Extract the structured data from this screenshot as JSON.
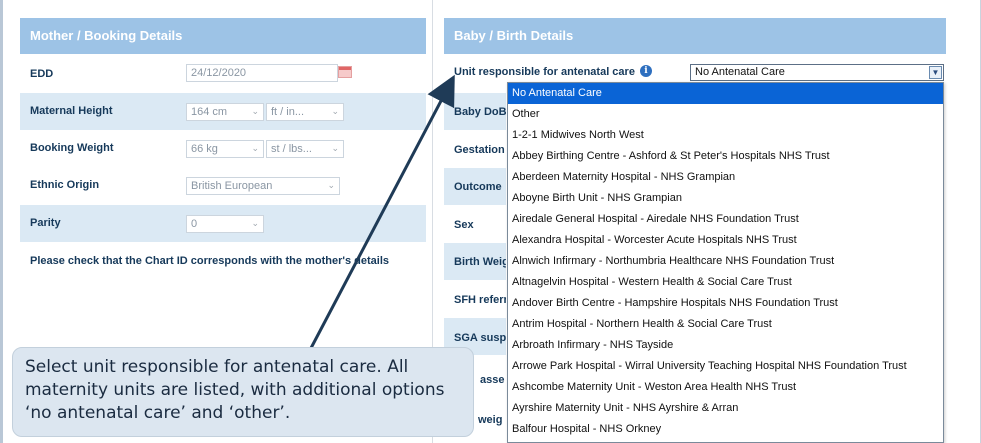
{
  "mother_panel": {
    "title": "Mother / Booking Details",
    "edd": {
      "label": "EDD",
      "value": "24/12/2020"
    },
    "maternal_height": {
      "label": "Maternal Height",
      "value": "164 cm",
      "unit": "ft / in..."
    },
    "booking_weight": {
      "label": "Booking Weight",
      "value": "66 kg",
      "unit": "st / lbs..."
    },
    "ethnic_origin": {
      "label": "Ethnic Origin",
      "value": "British European"
    },
    "parity": {
      "label": "Parity",
      "value": "0"
    },
    "note": "Please check that the Chart ID corresponds with the mother's details"
  },
  "baby_panel": {
    "title": "Baby / Birth Details",
    "unit_label": "Unit responsible for antenatal care",
    "unit_value": "No Antenatal Care",
    "partial_labels": [
      "Baby DoB",
      "Gestation",
      "Outcome",
      "Sex",
      "Birth Weig",
      "SFH referr",
      "SGA susp",
      "asse",
      "weig"
    ]
  },
  "dropdown": {
    "options": [
      "No Antenatal Care",
      "Other",
      "1-2-1 Midwives North West",
      "Abbey Birthing Centre - Ashford & St Peter's Hospitals NHS Trust",
      "Aberdeen Maternity Hospital - NHS Grampian",
      "Aboyne Birth Unit - NHS Grampian",
      "Airedale General Hospital - Airedale NHS Foundation Trust",
      "Alexandra Hospital - Worcester Acute Hospitals NHS Trust",
      "Alnwich Infirmary - Northumbria Healthcare NHS Foundation Trust",
      "Altnagelvin Hospital - Western Health & Social Care Trust",
      "Andover Birth Centre - Hampshire Hospitals NHS Foundation Trust",
      "Antrim Hospital - Northern Health & Social Care Trust",
      "Arbroath Infirmary - NHS Tayside",
      "Arrowe Park Hospital - Wirral University Teaching Hospital NHS Foundation Trust",
      "Ashcombe Maternity Unit - Weston Area Health NHS Trust",
      "Ayrshire Maternity Unit - NHS Ayrshire & Arran",
      "Balfour Hospital - NHS Orkney"
    ],
    "selected_index": 0
  },
  "callout": {
    "text": "Select unit responsible for antenatal care. All maternity units are listed, with additional options ‘no antenatal care’ and ‘other’."
  },
  "colors": {
    "header": "#9dc3e6",
    "row_shade": "#dbe9f4",
    "selection": "#0a64d6",
    "callout_bg": "#dce6f0",
    "arrow": "#1f3b57"
  },
  "icons": {
    "info": "info-icon",
    "calendar": "calendar-icon",
    "chevron": "chevron-down-icon"
  }
}
